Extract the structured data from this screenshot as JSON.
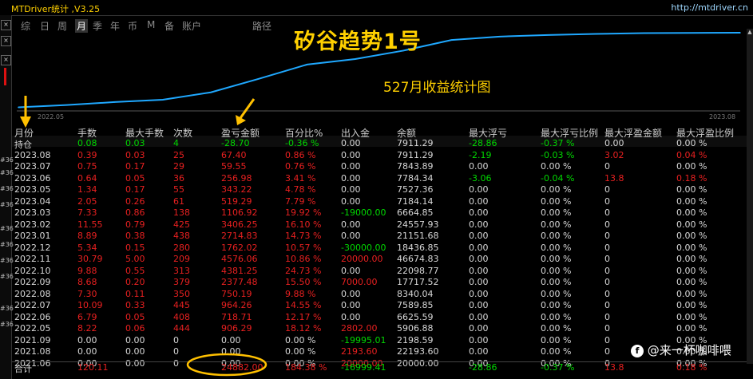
{
  "window": {
    "title": "MTDriver统计 ,V3.25",
    "url": "http://mtdriver.cn"
  },
  "tabs": [
    "综",
    "日",
    "周",
    "月",
    "季",
    "年",
    "币",
    "M",
    "备",
    "账户",
    "路径"
  ],
  "active_tab": "月",
  "chart": {
    "overlay_title": "矽谷趋势1号",
    "overlay_subtitle": "527月收益统计图",
    "x_start_label": "2022.05",
    "x_end_label": "2023.08",
    "line_color": "#1fa8ff"
  },
  "chart_data": {
    "type": "line",
    "title": "",
    "xlabel": "",
    "ylabel": "",
    "x": [
      "2022.05",
      "2022.06",
      "2022.07",
      "2022.08",
      "2022.09",
      "2022.10",
      "2022.11",
      "2022.12",
      "2023.01",
      "2023.02",
      "2023.03",
      "2023.04",
      "2023.05",
      "2023.06",
      "2023.07",
      "2023.08"
    ],
    "series": [
      {
        "values": [
          906.29,
          1625.0,
          2589.26,
          3339.45,
          5716.93,
          10098.18,
          14674.24,
          16436.26,
          19150.09,
          22556.34,
          23663.26,
          24182.55,
          24525.77,
          24782.75,
          24842.3,
          24909.7
        ]
      }
    ]
  },
  "table": {
    "headers": [
      "月份",
      "手数",
      "最大手数",
      "次数",
      "盈亏金额",
      "百分比%",
      "出入金",
      "余额",
      "最大浮亏",
      "最大浮亏比例",
      "最大浮盈金额",
      "最大浮盈比例"
    ],
    "rows": [
      [
        "持仓",
        "0.08",
        "0.03",
        "4",
        "-28.70",
        "-0.36 %",
        "0.00",
        "7911.29",
        "-28.86",
        "-0.37 %",
        "0.00",
        "0.00 %"
      ],
      [
        "2023.08",
        "0.39",
        "0.03",
        "25",
        "67.40",
        "0.86 %",
        "0.00",
        "7911.29",
        "-2.19",
        "-0.03 %",
        "3.02",
        "0.04 %"
      ],
      [
        "2023.07",
        "0.75",
        "0.17",
        "29",
        "59.55",
        "0.76 %",
        "0.00",
        "7843.89",
        "0.00",
        "0.00 %",
        "0",
        "0.00 %"
      ],
      [
        "2023.06",
        "0.64",
        "0.05",
        "36",
        "256.98",
        "3.41 %",
        "0.00",
        "7784.34",
        "-3.06",
        "-0.04 %",
        "13.8",
        "0.18 %"
      ],
      [
        "2023.05",
        "1.34",
        "0.17",
        "55",
        "343.22",
        "4.78 %",
        "0.00",
        "7527.36",
        "0.00",
        "0.00 %",
        "0",
        "0.00 %"
      ],
      [
        "2023.04",
        "2.05",
        "0.26",
        "61",
        "519.29",
        "7.79 %",
        "0.00",
        "7184.14",
        "0.00",
        "0.00 %",
        "0",
        "0.00 %"
      ],
      [
        "2023.03",
        "7.33",
        "0.86",
        "138",
        "1106.92",
        "19.92 %",
        "-19000.00",
        "6664.85",
        "0.00",
        "0.00 %",
        "0",
        "0.00 %"
      ],
      [
        "2023.02",
        "11.55",
        "0.79",
        "425",
        "3406.25",
        "16.10 %",
        "0.00",
        "24557.93",
        "0.00",
        "0.00 %",
        "0",
        "0.00 %"
      ],
      [
        "2023.01",
        "8.89",
        "0.38",
        "438",
        "2714.83",
        "14.73 %",
        "0.00",
        "21151.68",
        "0.00",
        "0.00 %",
        "0",
        "0.00 %"
      ],
      [
        "2022.12",
        "5.34",
        "0.15",
        "280",
        "1762.02",
        "10.57 %",
        "-30000.00",
        "18436.85",
        "0.00",
        "0.00 %",
        "0",
        "0.00 %"
      ],
      [
        "2022.11",
        "30.79",
        "5.00",
        "209",
        "4576.06",
        "10.86 %",
        "20000.00",
        "46674.83",
        "0.00",
        "0.00 %",
        "0",
        "0.00 %"
      ],
      [
        "2022.10",
        "9.88",
        "0.55",
        "313",
        "4381.25",
        "24.73 %",
        "0.00",
        "22098.77",
        "0.00",
        "0.00 %",
        "0",
        "0.00 %"
      ],
      [
        "2022.09",
        "8.68",
        "0.20",
        "379",
        "2377.48",
        "15.50 %",
        "7000.00",
        "17717.52",
        "0.00",
        "0.00 %",
        "0",
        "0.00 %"
      ],
      [
        "2022.08",
        "7.30",
        "0.11",
        "350",
        "750.19",
        "9.88 %",
        "0.00",
        "8340.04",
        "0.00",
        "0.00 %",
        "0",
        "0.00 %"
      ],
      [
        "2022.07",
        "10.09",
        "0.33",
        "445",
        "964.26",
        "14.55 %",
        "0.00",
        "7589.85",
        "0.00",
        "0.00 %",
        "0",
        "0.00 %"
      ],
      [
        "2022.06",
        "6.79",
        "0.05",
        "408",
        "718.71",
        "12.17 %",
        "0.00",
        "6625.59",
        "0.00",
        "0.00 %",
        "0",
        "0.00 %"
      ],
      [
        "2022.05",
        "8.22",
        "0.06",
        "444",
        "906.29",
        "18.12 %",
        "2802.00",
        "5906.88",
        "0.00",
        "0.00 %",
        "0",
        "0.00 %"
      ],
      [
        "2021.09",
        "0.00",
        "0.00",
        "0",
        "0.00",
        "0.00 %",
        "-19995.01",
        "2198.59",
        "0.00",
        "0.00 %",
        "0",
        "0.00 %"
      ],
      [
        "2021.08",
        "0.00",
        "0.00",
        "0",
        "0.00",
        "0.00 %",
        "2193.60",
        "22193.60",
        "0.00",
        "0.00 %",
        "0",
        "0.00 %"
      ],
      [
        "2021.06",
        "0.00",
        "0.00",
        "0",
        "0.00",
        "0.00 %",
        "20000.00",
        "20000.00",
        "0.00",
        "0.00 %",
        "0",
        "0.00 %"
      ]
    ],
    "footer": [
      "合计",
      "120.11",
      "",
      "",
      "24882.00",
      "184.38 %",
      "-16999.41",
      "",
      "-28.86",
      "-0.37 %",
      "13.8",
      "0.18 %"
    ]
  },
  "colors": {
    "positive": "#e82020",
    "negative": "#00d800",
    "neutral": "#d8d8d8",
    "accent": "#ffd000"
  },
  "left_symbols": [
    "#36",
    "#36",
    "#36",
    "#36",
    "#36",
    "#36",
    "#36",
    "#36",
    "#36",
    "#36"
  ],
  "watermark": {
    "text": "@来一杯咖啡喂",
    "icon": "f"
  }
}
